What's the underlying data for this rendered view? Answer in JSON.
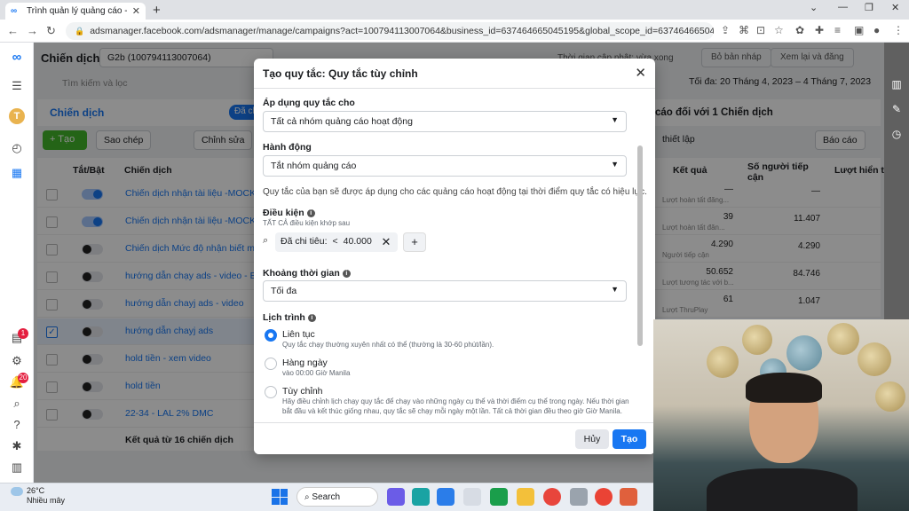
{
  "browser": {
    "tab_title": "Trình quản lý quảng cáo - Quản",
    "tab_close": "✕",
    "new_tab": "+",
    "url": "adsmanager.facebook.com/adsmanager/manage/campaigns?act=100794113007064&business_id=637464665045195&global_scope_id=637464665045195&nav_entry_p..."
  },
  "header": {
    "title": "Chiến dịch",
    "account": "G2b (100794113007064)",
    "updated": "Thời gian cập nhật: vừa xong",
    "discard": "Bỏ bản nháp",
    "review": "Xem lại và đăng",
    "search_placeholder": "Tìm kiếm và lọc",
    "date_range": "Tối đa: 20 Tháng 4, 2023 – 4 Tháng 7, 2023"
  },
  "tabs": {
    "campaigns": "Chiến dịch",
    "selected_pill": "Đã ch",
    "right_note": "cáo đối với 1 Chiến dịch"
  },
  "actions": {
    "create": "+ Tạo",
    "duplicate": "Sao chép",
    "edit": "Chỉnh sửa",
    "setup": "thiết lập",
    "reports": "Báo cáo"
  },
  "table": {
    "headers": {
      "toggle": "Tắt/Bật",
      "campaign": "Chiến dịch",
      "results": "Kết quả",
      "reach": "Số người tiếp cận",
      "impressions": "Lượt hiển th"
    },
    "rows": [
      {
        "name": "Chiến dịch nhận tài liệu -MOCKUP-",
        "on": true,
        "result": "—",
        "result_sub": "Lượt hoàn tất đăng...",
        "reach": "—"
      },
      {
        "name": "Chiến dịch nhận tài liệu -MOCKUP",
        "on": true,
        "result": "39",
        "result_sub": "Lượt hoàn tất đăn...",
        "reach": "11.407"
      },
      {
        "name": "Chiến dịch Mức độ nhận biết mới",
        "on": false,
        "result": "4.290",
        "result_sub": "Người tiếp cận",
        "reach": "4.290"
      },
      {
        "name": "hướng dẫn chạy ads - video - Bản s",
        "on": false,
        "result": "50.652",
        "result_sub": "Lượt tương tác với b...",
        "reach": "84.746"
      },
      {
        "name": "hướng dẫn chayj ads - video",
        "on": false,
        "result": "61",
        "result_sub": "Lượt ThruPlay",
        "reach": "1.047"
      },
      {
        "name": "hướng dẫn chayj ads",
        "on": false,
        "result": "",
        "result_sub": "",
        "reach": ""
      },
      {
        "name": "hold tiền - xem video",
        "on": false,
        "result": "",
        "result_sub": "",
        "reach": ""
      },
      {
        "name": "hold tiền",
        "on": false,
        "result": "",
        "result_sub": "",
        "reach": ""
      },
      {
        "name": "22-34 - LAL 2% DMC",
        "on": false,
        "result": "",
        "result_sub": "",
        "reach": ""
      }
    ],
    "footer": "Kết quả từ 16 chiến dịch"
  },
  "modal": {
    "title": "Tạo quy tắc: Quy tắc tùy chỉnh",
    "apply_label": "Áp dụng quy tắc cho",
    "apply_value": "Tất cả nhóm quảng cáo hoạt động",
    "action_label": "Hành động",
    "action_value": "Tắt nhóm quảng cáo",
    "rule_note": "Quy tắc của bạn sẽ được áp dụng cho các quảng cáo hoạt động tại thời điểm quy tắc có hiệu lực.",
    "conditions_label": "Điều kiện",
    "conditions_sub": "TẤT CẢ điều kiện khớp sau",
    "condition_metric": "Đã chi tiêu:",
    "condition_op": "<",
    "condition_value": "40.000 đ",
    "time_label": "Khoảng thời gian",
    "time_value": "Tối đa",
    "schedule_label": "Lịch trình",
    "schedule": [
      {
        "label": "Liên tục",
        "desc": "Quy tắc chạy thường xuyên nhất có thể (thường là 30-60 phút/lần).",
        "selected": true
      },
      {
        "label": "Hàng ngày",
        "desc": "vào 00:00 Giờ Manila",
        "selected": false
      },
      {
        "label": "Tùy chỉnh",
        "desc": "Hãy điều chỉnh lịch chạy quy tắc để chạy vào những ngày cụ thể và thời điểm cụ thể trong ngày. Nếu thời gian",
        "desc2": "bắt đầu và kết thúc giống nhau, quy tắc sẽ chạy mỗi ngày một lần. Tất cả thời gian đều theo giờ Giờ Manila.",
        "selected": false
      }
    ],
    "cancel": "Hủy",
    "create": "Tạo"
  },
  "taskbar": {
    "temp": "26°C",
    "weather": "Nhiều mây",
    "search": "Search"
  },
  "colors": {
    "accent": "#1877f2",
    "create_green": "#42b72a"
  }
}
